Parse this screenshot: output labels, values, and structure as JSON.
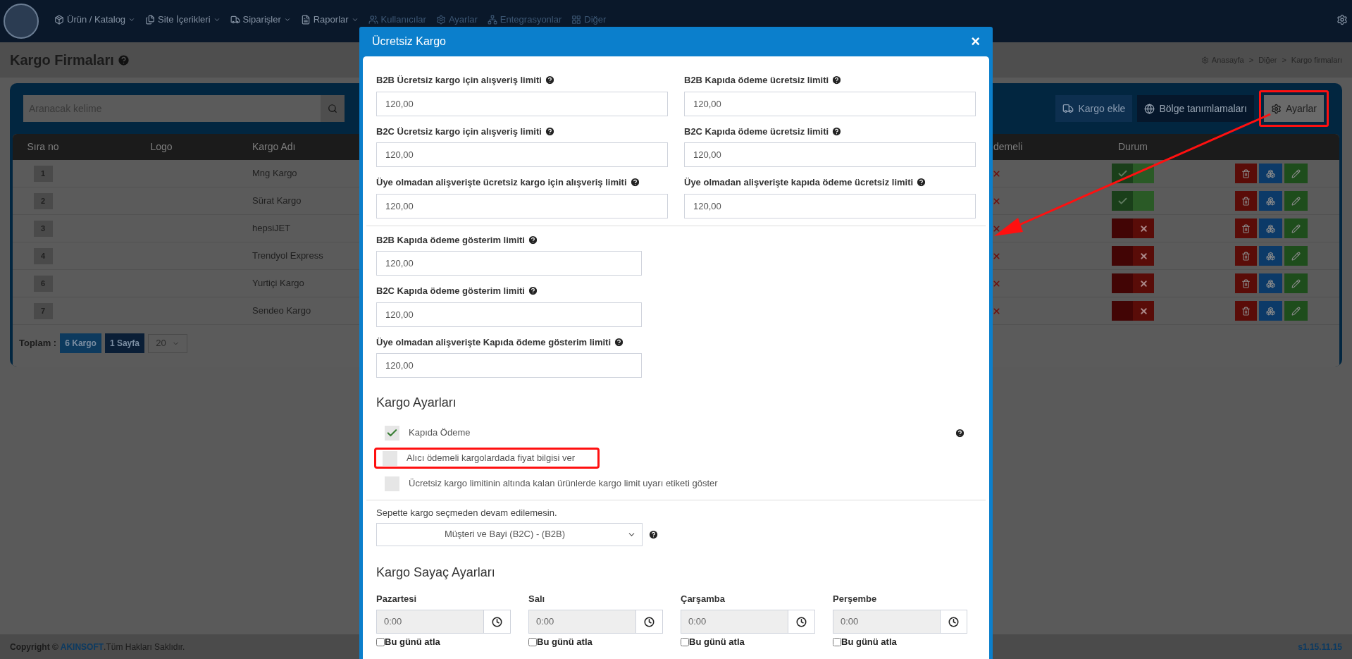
{
  "nav": {
    "items": [
      {
        "label": "Ürün / Katalog",
        "kind": "boxes",
        "dropdown": true
      },
      {
        "label": "Site İçerikleri",
        "kind": "files",
        "dropdown": true
      },
      {
        "label": "Siparişler",
        "kind": "truck",
        "dropdown": true
      },
      {
        "label": "Raporlar",
        "kind": "file",
        "dropdown": true
      },
      {
        "label": "Kullanıcılar",
        "kind": "users",
        "dropdown": false
      },
      {
        "label": "Ayarlar",
        "kind": "gears",
        "dropdown": false
      },
      {
        "label": "Entegrasyonlar",
        "kind": "network",
        "dropdown": false
      },
      {
        "label": "Diğer",
        "kind": "grid",
        "dropdown": false
      }
    ]
  },
  "page": {
    "title": "Kargo Firmaları",
    "breadcrumb": [
      "Anasayfa",
      ">",
      "Diğer",
      ">",
      "Kargo firmaları"
    ]
  },
  "toolbar": {
    "search_placeholder": "Aranacak kelime",
    "buttons": [
      {
        "label": "Kargo ekle",
        "kind": "truck",
        "annotated": false
      },
      {
        "label": "Bölge tanımlamaları",
        "kind": "globe",
        "annotated": false
      },
      {
        "label": "Ayarlar",
        "kind": "gears",
        "annotated": true
      }
    ]
  },
  "table": {
    "columns": [
      "Sıra no",
      "Logo",
      "Kargo Adı",
      "demeli",
      "Durum"
    ],
    "rows": [
      {
        "no": "1",
        "name": "Mng Kargo",
        "active": true
      },
      {
        "no": "2",
        "name": "Sürat Kargo",
        "active": true
      },
      {
        "no": "3",
        "name": "hepsiJET",
        "active": false
      },
      {
        "no": "4",
        "name": "Trendyol Express",
        "active": false
      },
      {
        "no": "6",
        "name": "Yurtiçi Kargo",
        "active": false
      },
      {
        "no": "7",
        "name": "Sendeo Kargo",
        "active": false
      }
    ],
    "footer": {
      "label": "Toplam :",
      "count": "6 Kargo",
      "pages": "1 Sayfa",
      "page_size": "20"
    }
  },
  "modal": {
    "title": "Ücretsiz Kargo",
    "close": "×",
    "limits": [
      {
        "label": "B2B Ücretsiz kargo için alışveriş limiti",
        "value": "120,00"
      },
      {
        "label": "B2B Kapıda ödeme ücretsiz limiti",
        "value": "120,00"
      },
      {
        "label": "B2C Ücretsiz kargo için alışveriş limiti",
        "value": "120,00"
      },
      {
        "label": "B2C Kapıda ödeme ücretsiz limiti",
        "value": "120,00"
      },
      {
        "label": "Üye olmadan alişverişte ücretsiz kargo için alışveriş limiti",
        "value": "120,00"
      },
      {
        "label": "Üye olmadan alişverişte kapıda ödeme ücretsiz limiti",
        "value": "120,00"
      }
    ],
    "display_limits": [
      {
        "label": "B2B Kapıda ödeme gösterim limiti",
        "value": "120,00"
      },
      {
        "label": "B2C Kapıda ödeme gösterim limiti",
        "value": "120,00"
      },
      {
        "label": "Üye olmadan alişverişte Kapıda ödeme gösterim limiti",
        "value": "120,00"
      }
    ],
    "settings_title": "Kargo Ayarları",
    "options": [
      {
        "label": "Kapıda Ödeme",
        "checked": true,
        "annotated": false
      },
      {
        "label": "Alıcı ödemeli kargolardada fiyat bilgisi ver",
        "checked": false,
        "annotated": true
      },
      {
        "label": "Ücretsiz kargo limitinin altında kalan ürünlerde kargo limit uyarı etiketi göster",
        "checked": false,
        "annotated": false
      }
    ],
    "select": {
      "label": "Sepette kargo seçmeden devam edilemesin.",
      "value": "Müşteri ve Bayi (B2C) - (B2B)"
    },
    "counter_title": "Kargo Sayaç Ayarları",
    "days": [
      {
        "name": "Pazartesi",
        "time": "0:00",
        "skip_label": "Bu günü atla",
        "skip": false
      },
      {
        "name": "Salı",
        "time": "0:00",
        "skip_label": "Bu günü atla",
        "skip": false
      },
      {
        "name": "Çarşamba",
        "time": "0:00",
        "skip_label": "Bu günü atla",
        "skip": false
      },
      {
        "name": "Perşembe",
        "time": "0:00",
        "skip_label": "Bu günü atla",
        "skip": false
      }
    ]
  },
  "footer": {
    "copyright_prefix": "Copyright ©",
    "brand": "AKINSOFT",
    "rights": ".Tüm Hakları Saklıdır.",
    "version": "s1.15.11.15"
  }
}
